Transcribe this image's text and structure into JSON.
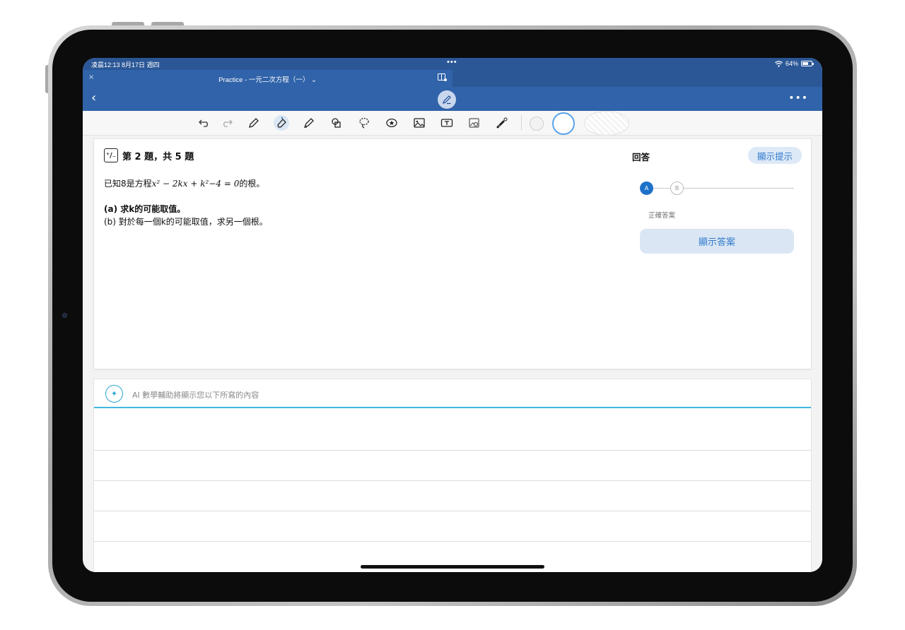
{
  "status_bar": {
    "time": "凌晨12:13  8月17日 週四",
    "dots": "•••",
    "battery": "64%",
    "wifi_icon": "wifi-icon"
  },
  "tab": {
    "close": "×",
    "title": "Practice - 一元二次方程（一） ⌄"
  },
  "nav": {
    "back": "‹",
    "more": "•••"
  },
  "toolbar": {
    "tools": [
      "undo-icon",
      "redo-icon",
      "pen-icon",
      "eraser-icon",
      "highlighter-icon",
      "shapes-icon",
      "lasso-icon",
      "sticker-icon",
      "image-icon",
      "textbox-icon",
      "image-search-icon",
      "laser-pointer-icon"
    ],
    "selected_tool": "eraser-icon",
    "colors": [
      "#d9d9d9",
      "#ffffff",
      "#f0f0f0"
    ]
  },
  "question": {
    "icon_text": "⁺∕₋",
    "title": "第 2 題，共 5 題",
    "stem_prefix": "已知8是方程",
    "stem_math": "x² − 2kx + k²−4 = 0",
    "stem_suffix": "的根。",
    "part_a": "(a) 求k的可能取值。",
    "part_b": "(b) 對於每一個k的可能取值，求另一個根。"
  },
  "answer_panel": {
    "title": "回答",
    "hint_button": "顯示提示",
    "step_a": "A",
    "step_b": "B",
    "correct_label": "正確答案",
    "show_answer_button": "顯示答案"
  },
  "ai_area": {
    "icon": "✦",
    "placeholder": "AI 數學輔助將顯示您以下所寫的內容"
  },
  "colors": {
    "header_blue": "#3063a9",
    "status_blue": "#2b5797",
    "accent": "#2f79cc",
    "ai_accent": "#2aa7d0"
  }
}
